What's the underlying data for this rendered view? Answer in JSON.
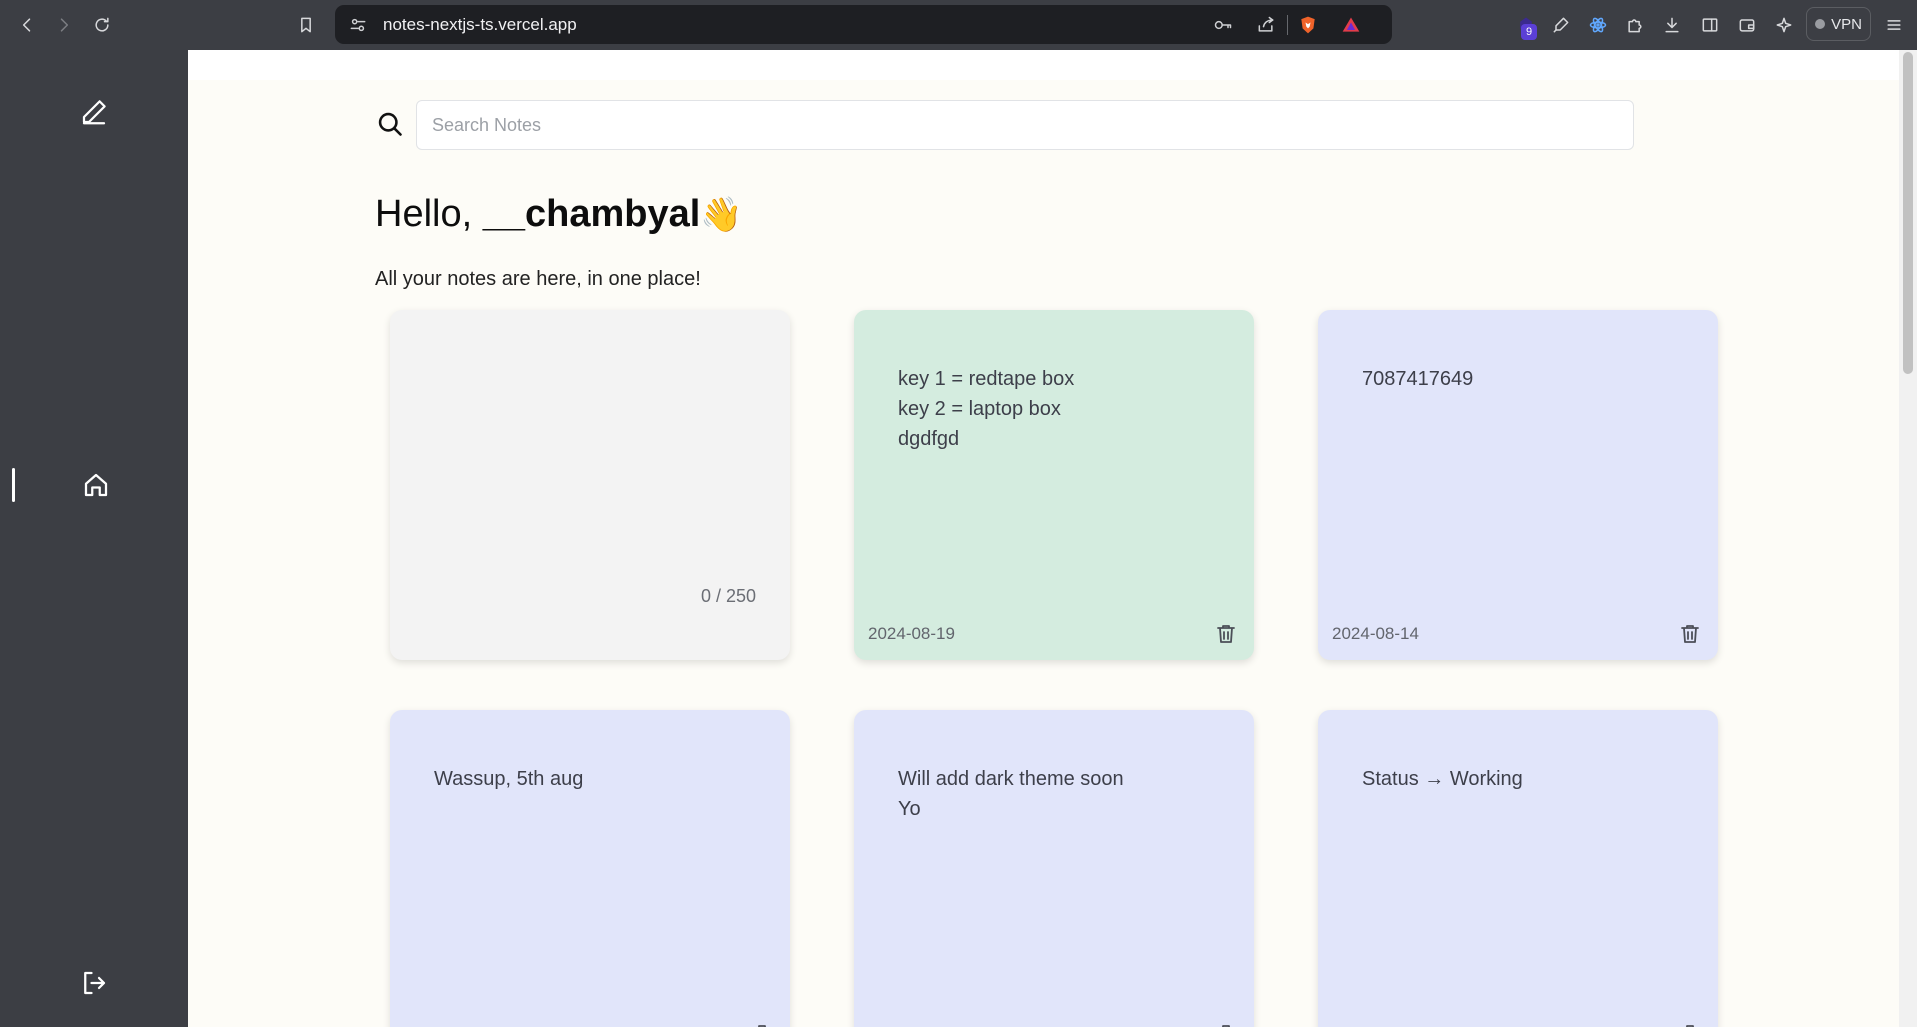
{
  "browser": {
    "url": "notes-nextjs-ts.vercel.app",
    "extension_badge_count": "9",
    "vpn_label": "VPN"
  },
  "search": {
    "placeholder": "Search Notes"
  },
  "greeting": {
    "prefix": "Hello, ",
    "username": "__chambyal",
    "emoji": "👋",
    "subtitle": "All your notes are here, in one place!"
  },
  "new_note": {
    "counter": "0 / 250",
    "color": "#f3f3f3"
  },
  "notes": [
    {
      "text": "key 1 = redtape box\nkey 2 = laptop box\ndgdfgd",
      "date": "2024-08-19",
      "color": "#d4ecdf"
    },
    {
      "text": "7087417649",
      "date": "2024-08-14",
      "color": "#e1e5fa"
    },
    {
      "text": "Wassup, 5th aug",
      "date": "",
      "color": "#e1e5fa"
    },
    {
      "text": "Will add dark theme soon\nYo",
      "date": "",
      "color": "#e1e5fa"
    },
    {
      "text": "Status → Working",
      "date": "",
      "color": "#e1e5fa"
    }
  ],
  "colors": {
    "sidebar": "#3c3e44",
    "background": "#fdfcf7",
    "url_bar": "#1e1f23"
  }
}
